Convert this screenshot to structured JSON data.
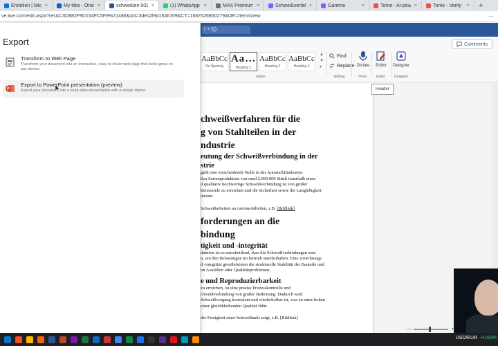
{
  "browser": {
    "tabs": [
      {
        "label": "Erstellen | Microso",
        "color": "#0078d4",
        "active": false
      },
      {
        "label": "My files - OneDriv",
        "color": "#0364b8",
        "active": false
      },
      {
        "label": "schweißen 003.do",
        "color": "#2b579a",
        "active": true
      },
      {
        "label": "(1) WhatsApp",
        "color": "#25d366",
        "active": false
      },
      {
        "label": "MAX Premium - (",
        "color": "#6d6d6d",
        "active": false
      },
      {
        "label": "Schweißverfahren",
        "color": "#7b61ff",
        "active": false
      },
      {
        "label": "Gamma",
        "color": "#8b5cf6",
        "active": false
      },
      {
        "label": "Tome - AI-powere",
        "color": "#e5534b",
        "active": false
      },
      {
        "label": "Tome - Verify",
        "color": "#e5534b",
        "active": false
      }
    ],
    "new_tab": "+",
    "close": "×",
    "address": "ve.live.com/edit.aspx?resid=3D882F9D154FC5F9%21486&cid=3de02f9d154fc5f9&CT=1687626850279&OR=ItemsView"
  },
  "word": {
    "search_placeholder": "r + Q)",
    "comments_label": "Comments",
    "styles": [
      {
        "preview": "AaBbCc",
        "name": "No Spacing",
        "selected": false,
        "big": false
      },
      {
        "preview": "Aa…",
        "name": "Heading 1",
        "selected": true,
        "big": true
      },
      {
        "preview": "AaBbCc",
        "name": "Heading 2",
        "selected": false,
        "big": false
      },
      {
        "preview": "AaBbCc",
        "name": "Heading 3",
        "selected": false,
        "big": false
      }
    ],
    "groups": {
      "styles": "Styles",
      "editing": "Editing",
      "voice": "Voice",
      "editor": "Editor",
      "designer": "Designer"
    },
    "find_label": "Find",
    "replace_label": "Replace",
    "dictate_label": "Dictate",
    "editor_label": "Editor",
    "designer_label": "Designer",
    "header_tag": "Header",
    "zoom_minus": "—",
    "zoom_plus": "+"
  },
  "document": {
    "title_lines": [
      "chweißverfahren für die",
      "g von Stahlteilen in der",
      "ndustrie"
    ],
    "section1": {
      "heading_lines": [
        "eutung der Schweißverbindung in der",
        "strie"
      ],
      "body": [
        "gielt eine entscheidende Rolle in der Automobilindustrie.",
        "ßen Serienproduktion von rund 2.000.000 Stück innerhalb eines",
        "d qualitativ hochwertige Schweißverbindung ist von großer",
        "ktionsziele zu erreichen und die Sicherheit sowie die Langlebigkeit",
        "leisten."
      ],
      "caption_prefix": "Schweißarbeiten an Automobilteilen, z.B. ",
      "caption_link": "[Bildlink]"
    },
    "section2": {
      "heading_lines": [
        "forderungen an die",
        "bindung"
      ],
      "sub1": {
        "heading": "tigkeit und -integrität",
        "body": [
          "duktion ist es entscheidend, dass die Schweißverbindungen eine",
          "n, um den Belastungen im Betrieb standzuhalten. Eine zuverlässige",
          "d -integrität gewährleisten die strukturelle Stabilität der Bauteile und",
          "on Ausfällen oder Qualitätsproblemen."
        ]
      },
      "sub2": {
        "heading": "e und Reproduzierbarkeit",
        "body": [
          " zu erreichen, ist eine präzise Prozesskontrolle und",
          "chweißverbindung von großer Bedeutung. Dadurch wird",
          "Schweißvorgang konsistent und wiederholbar ist, was zu einer hohen",
          "einer gleichbleibenden Qualität führt."
        ]
      },
      "caption_partial": "der Festigkeit einer Schweißnaht zeigt, z.B. [Bildlink]"
    }
  },
  "export_panel": {
    "title": "Export",
    "options": [
      {
        "title": "Transform to Web Page",
        "description": "Transform your document into an interactive, easy-to-share web page that looks great on any device.",
        "desc_line1": "Transform your document into an interactive, easy-to-share web page that looks great on",
        "desc_line2": "any device."
      },
      {
        "title": "Export to PowerPoint presentation (preview)",
        "description": "Export your document into a multi-slide presentation with a design theme."
      }
    ]
  },
  "taskbar": {
    "icon_colors": [
      "#0078d4",
      "#f25022",
      "#ffb900",
      "#f7630c",
      "#2b579a",
      "#b7472a",
      "#7719aa",
      "#217346",
      "#0f6cbd",
      "#d13438",
      "#4285f4",
      "#10893e",
      "#1a73e8",
      "#333333",
      "#5c2d91",
      "#e81123",
      "#0099bc",
      "#ff8c00"
    ],
    "ticker": "USD/EUR",
    "change": "+0,60%"
  },
  "colors": {
    "word_blue": "#2b579a",
    "accent": "#c43e1c"
  }
}
